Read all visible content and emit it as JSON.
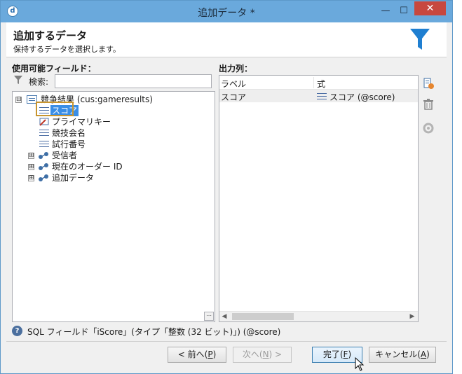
{
  "window": {
    "title": "追加データ *",
    "min_glyph": "—",
    "max_glyph": "☐",
    "close_glyph": "✕",
    "app_glyph": "d"
  },
  "header": {
    "title": "追加するデータ",
    "subtitle": "保持するデータを選択します。"
  },
  "fields_panel": {
    "label": "使用可能フィールド：",
    "search_label": "検索:",
    "search_value": "",
    "tree": [
      {
        "label": "競争結果 (cus:gameresults)",
        "icon": "table-icon",
        "expander": "⊟"
      },
      {
        "label": "スコア",
        "icon": "field-icon",
        "selected": true
      },
      {
        "label": "プライマリキー",
        "icon": "key-icon"
      },
      {
        "label": "競技会名",
        "icon": "field-icon"
      },
      {
        "label": "試行番号",
        "icon": "field-icon"
      },
      {
        "label": "受信者",
        "icon": "link-icon",
        "expander": "⊞"
      },
      {
        "label": "現在のオーダー ID",
        "icon": "link-icon",
        "expander": "⊞"
      },
      {
        "label": "追加データ",
        "icon": "link-icon",
        "expander": "⊞"
      }
    ],
    "grip_glyph": "⋯"
  },
  "output_panel": {
    "label": "出力列：",
    "columns": [
      "ラベル",
      "式"
    ],
    "rows": [
      {
        "label": "スコア",
        "expression": "スコア (@score)"
      }
    ]
  },
  "help": {
    "glyph": "?",
    "text": "SQL フィールド「iScore」(タイプ「整数 (32 ビット)」) (@score)"
  },
  "buttons": {
    "prev": {
      "text": "< 前へ(",
      "key": "P",
      "end": ")"
    },
    "next": {
      "text": "次へ(",
      "key": "N",
      "end": ") >"
    },
    "finish": {
      "text": "完了(",
      "key": "F",
      "end": ")"
    },
    "cancel": {
      "text": "キャンセル(",
      "key": "A",
      "end": ")"
    }
  },
  "colors": {
    "titlebar": "#6aa9dc",
    "close": "#c7483f",
    "selection": "#3a8ee6",
    "highlight_frame": "#c8952e",
    "funnel": "#1f7fd1"
  }
}
